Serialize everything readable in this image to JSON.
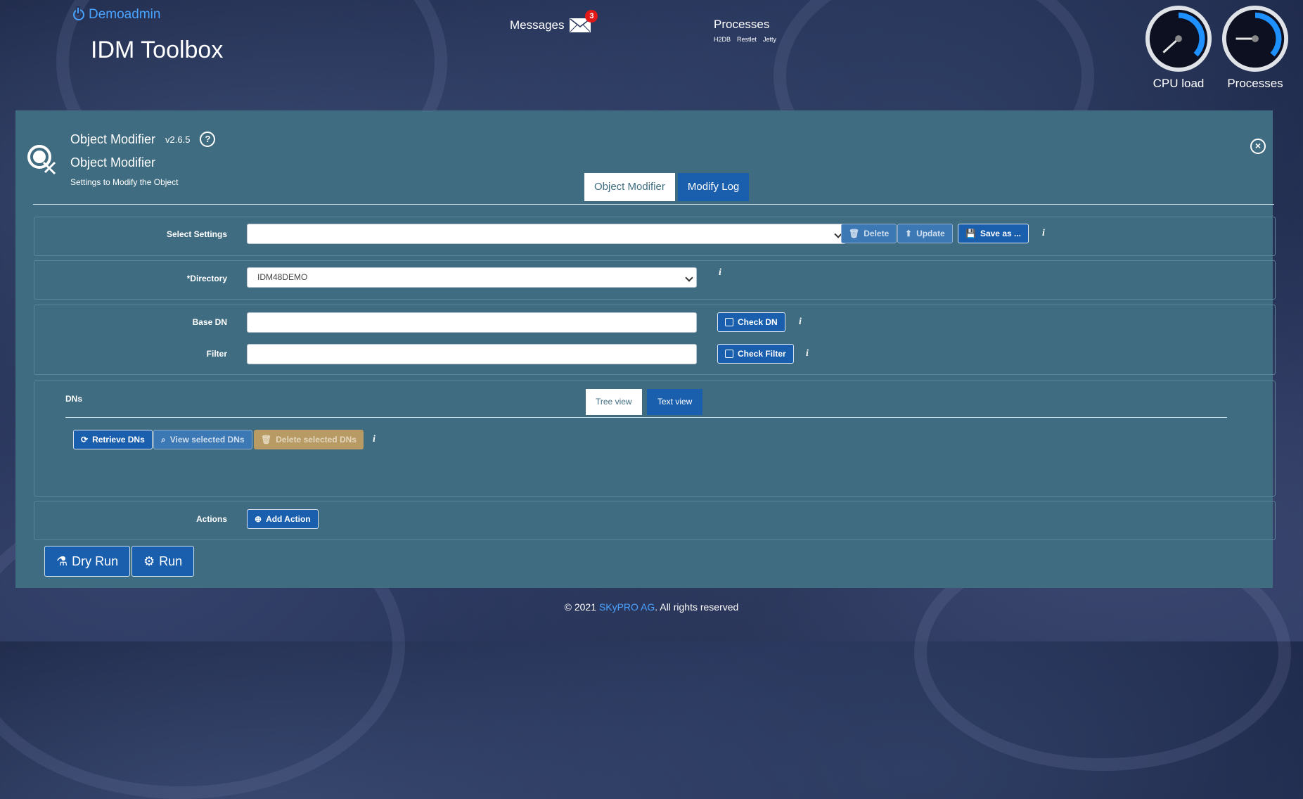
{
  "header": {
    "user_name": "Demoadmin",
    "app_title": "IDM Toolbox",
    "messages_label": "Messages",
    "messages_count": "3",
    "processes_title": "Processes",
    "process_items": [
      "H2DB",
      "Restlet",
      "Jetty"
    ],
    "gauges": [
      {
        "label": "CPU load",
        "accent": "#1e90ff"
      },
      {
        "label": "Processes",
        "accent": "#1e90ff"
      }
    ]
  },
  "panel": {
    "title": "Object Modifier",
    "version": "v2.6.5",
    "subtitle": "Object Modifier",
    "description": "Settings to Modify the Object",
    "tabs": [
      {
        "label": "Object Modifier",
        "active": true
      },
      {
        "label": "Modify Log",
        "active": false
      }
    ]
  },
  "form": {
    "select_settings_label": "Select Settings",
    "select_settings_value": "",
    "delete_label": "Delete",
    "update_label": "Update",
    "save_as_label": "Save as ...",
    "directory_label": "*Directory",
    "directory_value": "IDM48DEMO",
    "base_dn_label": "Base DN",
    "base_dn_value": "",
    "check_dn_label": "Check DN",
    "filter_label": "Filter",
    "filter_value": "",
    "check_filter_label": "Check Filter",
    "info_glyph": "i"
  },
  "dns": {
    "label": "DNs",
    "tree_view_label": "Tree view",
    "text_view_label": "Text view",
    "retrieve_label": "Retrieve DNs",
    "view_selected_label": "View selected DNs",
    "delete_selected_label": "Delete selected DNs"
  },
  "actions": {
    "label": "Actions",
    "add_action_label": "Add Action",
    "dry_run_label": "Dry Run",
    "run_label": "Run"
  },
  "footer": {
    "prefix": "© 2021 ",
    "company": "SKyPRO AG",
    "suffix": ". All rights reserved"
  },
  "colors": {
    "panel_bg": "#3f6c80",
    "primary_button": "#1a5fae",
    "link": "#4aa3ff",
    "delete_selected": "#b89a64",
    "badge": "#e01818"
  }
}
